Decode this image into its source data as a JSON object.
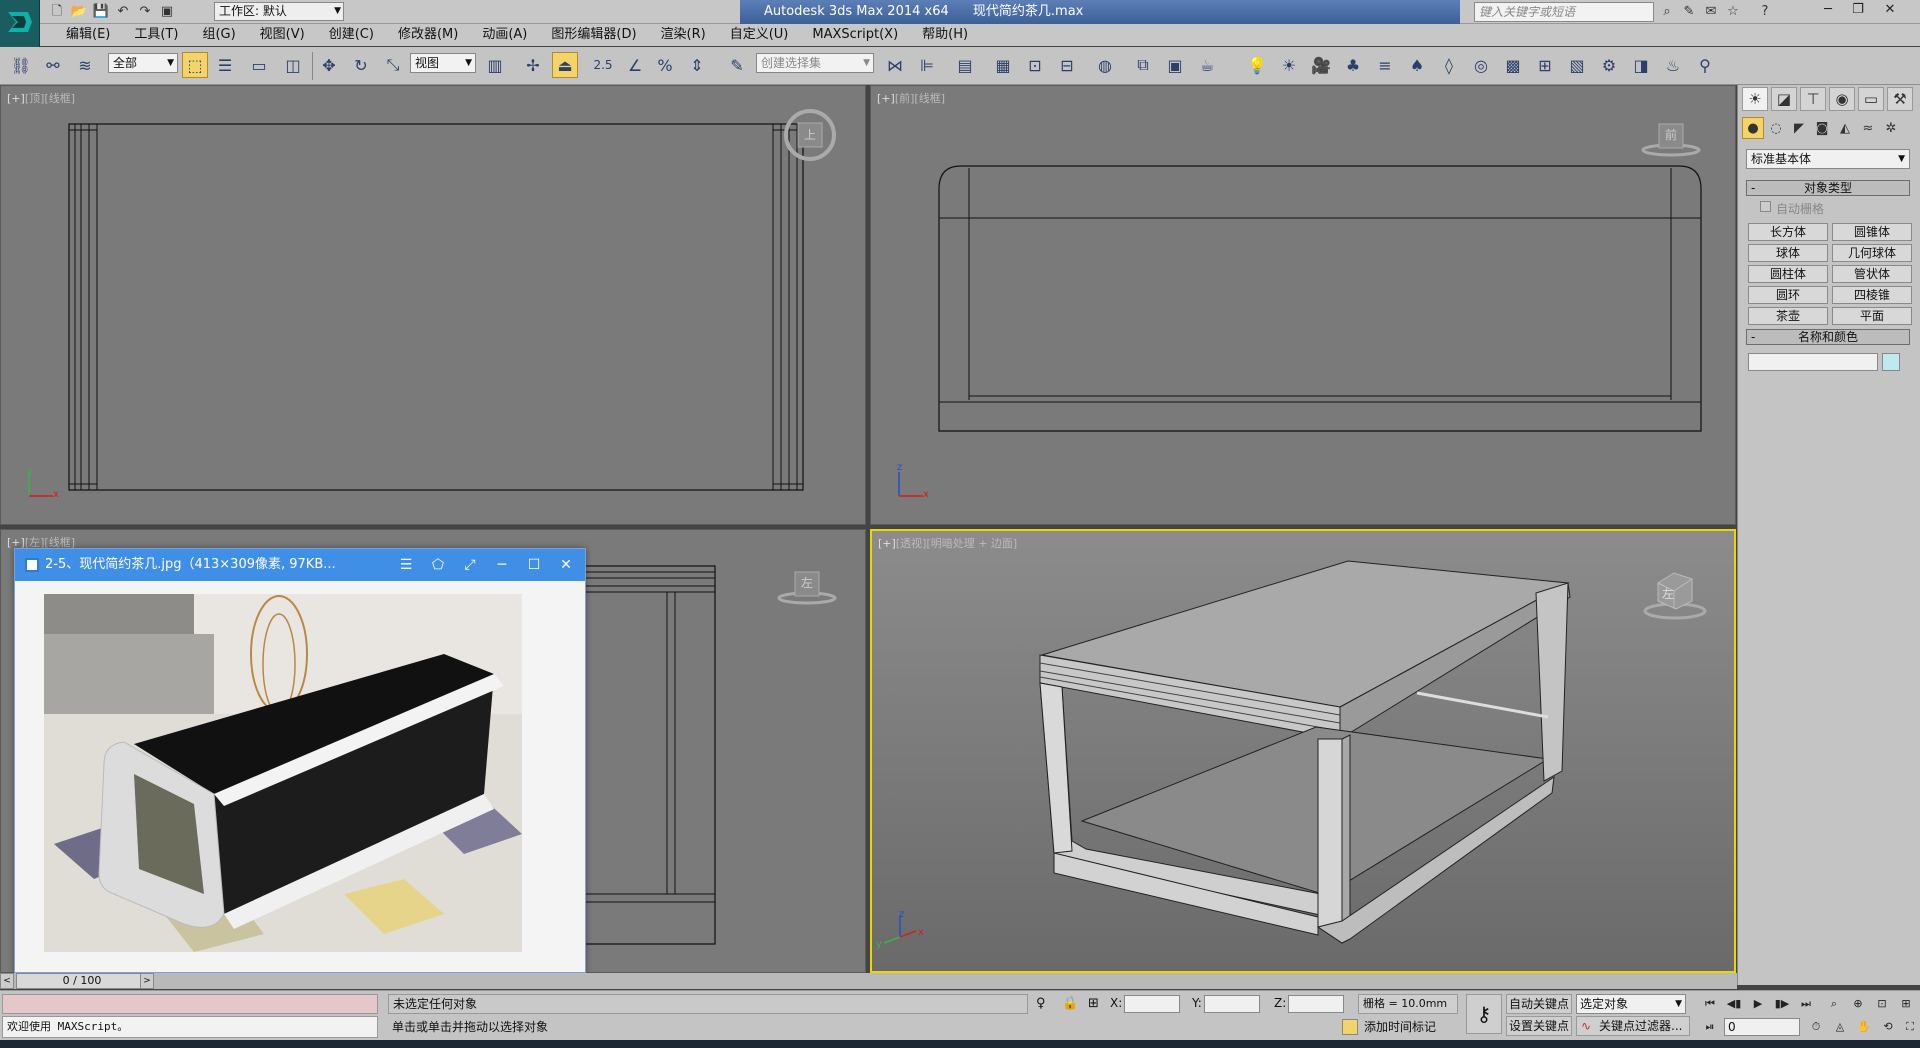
{
  "titlebar": {
    "app_title": "Autodesk 3ds Max  2014 x64",
    "file_name": "现代简约茶几.max",
    "workspace": "工作区: 默认",
    "search_placeholder": "键入关键字或短语"
  },
  "menu": [
    "编辑(E)",
    "工具(T)",
    "组(G)",
    "视图(V)",
    "创建(C)",
    "修改器(M)",
    "动画(A)",
    "图形编辑器(D)",
    "渲染(R)",
    "自定义(U)",
    "MAXScript(X)",
    "帮助(H)"
  ],
  "toolbar": {
    "filter": "全部",
    "ref_coord": "视图",
    "snap_value": "2.5",
    "named_selection": "创建选择集"
  },
  "viewports": {
    "top": {
      "label_plus": "[+]",
      "label_view": "[顶]",
      "label_shade": "[线框]",
      "cube_label": "上"
    },
    "front": {
      "label_plus": "[+]",
      "label_view": "[前]",
      "label_shade": "[线框]",
      "cube_label": "前"
    },
    "left": {
      "label_plus": "[+]",
      "label_view": "[左]",
      "label_shade": "[线框]",
      "cube_label": "左"
    },
    "persp": {
      "label_plus": "[+]",
      "label_view": "[透视]",
      "label_shade": "[明暗处理 + 边面]",
      "cube_label": "左"
    }
  },
  "axes": {
    "x": "x",
    "y": "y",
    "z": "z"
  },
  "command_panel": {
    "primitive_type": "标准基本体",
    "object_type_title": "对象类型",
    "autogrid": "自动栅格",
    "buttons": [
      "长方体",
      "圆锥体",
      "球体",
      "几何球体",
      "圆柱体",
      "管状体",
      "圆环",
      "四棱锥",
      "茶壶",
      "平面"
    ],
    "name_color_title": "名称和颜色"
  },
  "image_viewer": {
    "title": "2-5、现代简约茶几.jpg（413×309像素, 97KB..."
  },
  "timeline": {
    "frame": "0 / 100"
  },
  "status": {
    "listener_text": "欢迎使用 MAXScript。",
    "selection": "未选定任何对象",
    "prompt": "单击或单击并拖动以选择对象",
    "x_label": "X:",
    "y_label": "Y:",
    "z_label": "Z:",
    "grid": "栅格 = 10.0mm",
    "add_time_tag": "添加时间标记",
    "auto_key": "自动关键点",
    "set_key": "设置关键点",
    "selected_obj": "选定对象",
    "key_filters": "关键点过滤器...",
    "current_frame": "0"
  },
  "colors": {
    "accent": "#f5d36b",
    "active_viewport": "#e8d800",
    "viewer_title": "#3f8fe6"
  }
}
